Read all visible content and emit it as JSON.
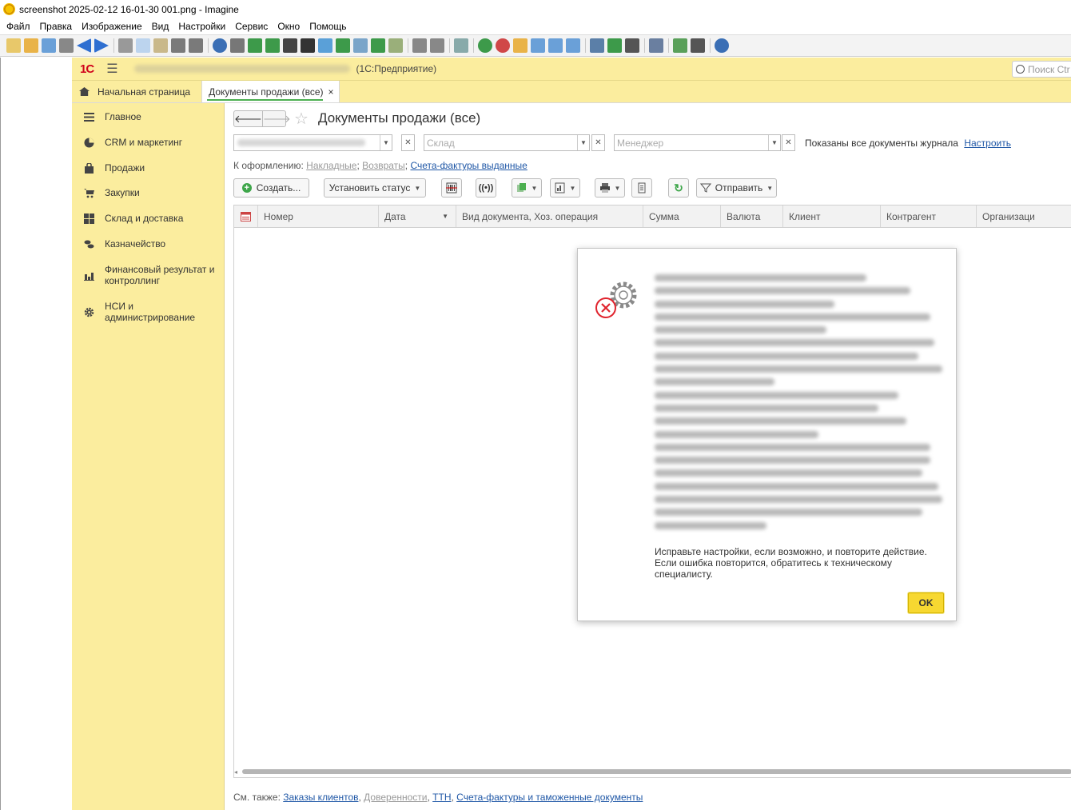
{
  "window": {
    "title": "screenshot 2025-02-12 16-01-30 001.png - Imagine",
    "menu": [
      "Файл",
      "Правка",
      "Изображение",
      "Вид",
      "Настройки",
      "Сервис",
      "Окно",
      "Помощь"
    ]
  },
  "c1": {
    "logo": "1С",
    "app_mode": "(1С:Предприятие)",
    "search_placeholder": "Поиск Ctr"
  },
  "tabs": {
    "home": "Начальная страница",
    "active": "Документы продажи (все)",
    "close": "×"
  },
  "sidebar": {
    "items": [
      {
        "label": "Главное",
        "icon": "menu-icon"
      },
      {
        "label": "CRM и маркетинг",
        "icon": "pie-chart-icon"
      },
      {
        "label": "Продажи",
        "icon": "bag-icon"
      },
      {
        "label": "Закупки",
        "icon": "cart-icon"
      },
      {
        "label": "Склад и доставка",
        "icon": "grid-icon"
      },
      {
        "label": "Казначейство",
        "icon": "coins-icon"
      },
      {
        "label": "Финансовый результат и контроллинг",
        "icon": "bar-chart-icon"
      },
      {
        "label": "НСИ и администрирование",
        "icon": "gear-icon"
      }
    ]
  },
  "main": {
    "title": "Документы продажи (все)",
    "filters": {
      "warehouse_placeholder": "Склад",
      "manager_placeholder": "Менеджер",
      "shown_text": "Показаны все документы журнала",
      "configure_link": "Настроить"
    },
    "todo": {
      "label": "К оформлению:",
      "links": [
        "Накладные",
        "Возвраты",
        "Счета-фактуры выданные"
      ]
    },
    "commands": {
      "create": "Создать...",
      "set_status": "Установить статус",
      "send": "Отправить"
    },
    "columns": [
      "Номер",
      "Дата",
      "Вид документа, Хоз. операция",
      "Сумма",
      "Валюта",
      "Клиент",
      "Контрагент",
      "Организаци"
    ],
    "see_also": {
      "label": "См. также:",
      "links": [
        "Заказы клиентов",
        "Доверенности",
        "ТТН",
        "Счета-фактуры и таможенные документы"
      ]
    }
  },
  "dialog": {
    "message": "Исправьте настройки, если возможно, и повторите действие. Если ошибка повторится, обратитесь к техническому специалисту.",
    "ok": "OK"
  },
  "colors": {
    "yellow_panel": "#fbed9e",
    "ok_button": "#f7d831",
    "error_red": "#e0242e",
    "link_blue": "#1f57a6"
  }
}
